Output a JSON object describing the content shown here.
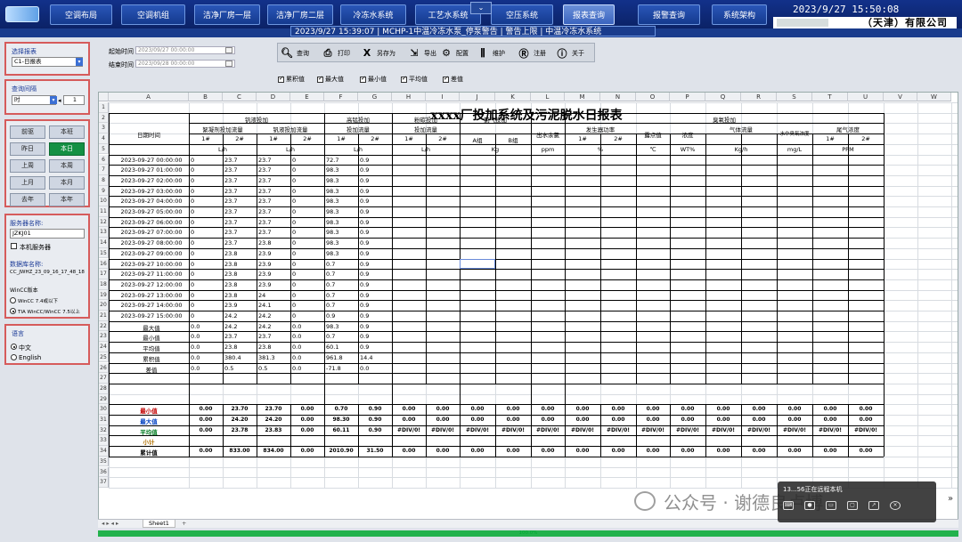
{
  "nav": {
    "items": [
      "空调布局",
      "空调机组",
      "洁净厂房一层",
      "洁净厂房二层",
      "冷冻水系统",
      "工艺水系统",
      "空压系统",
      "报表查询",
      "报警查询",
      "系统架构"
    ],
    "active": "报表查询",
    "datetime": "2023/9/27 15:50:08",
    "company": "（天津）有限公司",
    "ticker": "2023/9/27 15:39:07 | MCHP-1中温冷冻水泵_停泵警告 | 警告上限 | 中温冷冻水系统"
  },
  "sidebar": {
    "report_label": "选择报表",
    "report_value": "C1-日报表",
    "interval_label": "查询间隔",
    "interval_unit": "时",
    "interval_value": "1",
    "quick_buttons": [
      "前驱",
      "本班",
      "昨日",
      "本日",
      "上周",
      "本周",
      "上月",
      "本月",
      "去年",
      "本年"
    ],
    "quick_selected": "本日",
    "server_label": "服务器名称:",
    "server_value": "JZKJ01",
    "local_server": "本机服务器",
    "db_label": "数据库名称:",
    "db_value": "CC_JWHZ_23_09_16_17_48_18",
    "wincc_label": "WinCC版本",
    "wincc_options": [
      "WinCC 7.4或以下",
      "TIA WinCC/WinCC 7.5以上"
    ],
    "lang_label": "语言",
    "lang_options": [
      "中文",
      "English"
    ]
  },
  "timebar": {
    "start_label": "起始时间",
    "start_value": "2023/09/27 00:00:00",
    "end_label": "结束时间",
    "end_value": "2023/09/28 00:00:00"
  },
  "toolbar": {
    "buttons": [
      {
        "icon": "search-icon",
        "label": "查询"
      },
      {
        "icon": "printer-icon",
        "label": "打印"
      },
      {
        "icon": "excel-icon",
        "label": "另存为"
      },
      {
        "icon": "export-icon",
        "label": "导出"
      },
      {
        "icon": "gear-icon",
        "label": "配置"
      },
      {
        "icon": "maintenance-icon",
        "label": "维护"
      },
      {
        "icon": "register-icon",
        "label": "注册"
      },
      {
        "icon": "info-icon",
        "label": "关于"
      }
    ]
  },
  "options": [
    "累积值",
    "最大值",
    "最小值",
    "平均值",
    "差值"
  ],
  "sheet": {
    "columns": [
      "A",
      "B",
      "C",
      "D",
      "E",
      "F",
      "G",
      "H",
      "I",
      "J",
      "K",
      "L",
      "M",
      "N",
      "O",
      "P",
      "Q",
      "R",
      "S",
      "T",
      "U",
      "V",
      "W"
    ],
    "title": "xxxx厂投加系统及污泥脱水日报表",
    "tab_name": "Sheet1",
    "headers": {
      "time": "日期时间",
      "g1": "钒液投加",
      "g1a": "絮凝剂投加流量",
      "g1b": "钒液投加流量",
      "g2": "高锰投加",
      "g2a": "投加流量",
      "g3": "粉碳投加",
      "g3a": "投加流量",
      "g4": "氯气投加",
      "g4a": "A组",
      "g4b": "B组",
      "out": "出水余氯",
      "g5": "臭氧投加",
      "gen": "发生器功率",
      "dew": "露点值",
      "conc": "浓度",
      "gas": "气体流量",
      "water": "水中臭氧浓度",
      "tail": "尾气浓度",
      "n1": "1#",
      "n2": "2#",
      "u_lh": "L/h",
      "u_kg": "Kg",
      "u_ppm": "ppm",
      "u_pct": "%",
      "u_c": "℃",
      "u_wt": "WT%",
      "u_kgh": "Kg/h",
      "u_mgl": "mg/L",
      "u_PPM": "PPM"
    },
    "hourly": [
      [
        "2023-09-27 00:00:00",
        "0",
        "23.7",
        "23.7",
        "0",
        "72.7",
        "0.9"
      ],
      [
        "2023-09-27 01:00:00",
        "0",
        "23.7",
        "23.7",
        "0",
        "98.3",
        "0.9"
      ],
      [
        "2023-09-27 02:00:00",
        "0",
        "23.7",
        "23.7",
        "0",
        "98.3",
        "0.9"
      ],
      [
        "2023-09-27 03:00:00",
        "0",
        "23.7",
        "23.7",
        "0",
        "98.3",
        "0.9"
      ],
      [
        "2023-09-27 04:00:00",
        "0",
        "23.7",
        "23.7",
        "0",
        "98.3",
        "0.9"
      ],
      [
        "2023-09-27 05:00:00",
        "0",
        "23.7",
        "23.7",
        "0",
        "98.3",
        "0.9"
      ],
      [
        "2023-09-27 06:00:00",
        "0",
        "23.7",
        "23.7",
        "0",
        "98.3",
        "0.9"
      ],
      [
        "2023-09-27 07:00:00",
        "0",
        "23.7",
        "23.7",
        "0",
        "98.3",
        "0.9"
      ],
      [
        "2023-09-27 08:00:00",
        "0",
        "23.7",
        "23.8",
        "0",
        "98.3",
        "0.9"
      ],
      [
        "2023-09-27 09:00:00",
        "0",
        "23.8",
        "23.9",
        "0",
        "98.3",
        "0.9"
      ],
      [
        "2023-09-27 10:00:00",
        "0",
        "23.8",
        "23.9",
        "0",
        "0.7",
        "0.9"
      ],
      [
        "2023-09-27 11:00:00",
        "0",
        "23.8",
        "23.9",
        "0",
        "0.7",
        "0.9"
      ],
      [
        "2023-09-27 12:00:00",
        "0",
        "23.8",
        "23.9",
        "0",
        "0.7",
        "0.9"
      ],
      [
        "2023-09-27 13:00:00",
        "0",
        "23.8",
        "24",
        "0",
        "0.7",
        "0.9"
      ],
      [
        "2023-09-27 14:00:00",
        "0",
        "23.9",
        "24.1",
        "0",
        "0.7",
        "0.9"
      ],
      [
        "2023-09-27 15:00:00",
        "0",
        "24.2",
        "24.2",
        "0",
        "0.9",
        "0.9"
      ]
    ],
    "stats": [
      [
        "最大值",
        "0.0",
        "24.2",
        "24.2",
        "0.0",
        "98.3",
        "0.9"
      ],
      [
        "最小值",
        "0.0",
        "23.7",
        "23.7",
        "0.0",
        "0.7",
        "0.9"
      ],
      [
        "平均值",
        "0.0",
        "23.8",
        "23.8",
        "0.0",
        "60.1",
        "0.9"
      ],
      [
        "累积值",
        "0.0",
        "380.4",
        "381.3",
        "0.0",
        "961.8",
        "14.4"
      ],
      [
        "差值",
        "0.0",
        "0.5",
        "0.5",
        "0.0",
        "-71.8",
        "0.0"
      ]
    ],
    "summary": [
      {
        "label": "最小值",
        "color": "#c00000",
        "vals": [
          "0.00",
          "23.70",
          "23.70",
          "0.00",
          "0.70",
          "0.90",
          "0.00",
          "0.00",
          "0.00",
          "0.00",
          "0.00",
          "0.00",
          "0.00",
          "0.00",
          "0.00",
          "0.00",
          "0.00",
          "0.00",
          "0.00",
          "0.00"
        ]
      },
      {
        "label": "最大值",
        "color": "#0040c0",
        "vals": [
          "0.00",
          "24.20",
          "24.20",
          "0.00",
          "98.30",
          "0.90",
          "0.00",
          "0.00",
          "0.00",
          "0.00",
          "0.00",
          "0.00",
          "0.00",
          "0.00",
          "0.00",
          "0.00",
          "0.00",
          "0.00",
          "0.00",
          "0.00"
        ]
      },
      {
        "label": "平均值",
        "color": "#007a20",
        "vals": [
          "0.00",
          "23.78",
          "23.83",
          "0.00",
          "60.11",
          "0.90",
          "#DIV/0!",
          "#DIV/0!",
          "#DIV/0!",
          "#DIV/0!",
          "#DIV/0!",
          "#DIV/0!",
          "#DIV/0!",
          "#DIV/0!",
          "#DIV/0!",
          "#DIV/0!",
          "#DIV/0!",
          "#DIV/0!",
          "#DIV/0!",
          "#DIV/0!"
        ]
      },
      {
        "label": "小计",
        "color": "#b07000",
        "vals": []
      },
      {
        "label": "累计值",
        "color": "#000000",
        "vals": [
          "0.00",
          "833.00",
          "834.00",
          "0.00",
          "2010.90",
          "31.50",
          "0.00",
          "0.00",
          "0.00",
          "0.00",
          "0.00",
          "0.00",
          "0.00",
          "0.00",
          "0.00",
          "0.00",
          "0.00",
          "0.00",
          "0.00",
          "0.00"
        ]
      }
    ]
  },
  "status": {
    "progress_text": "100.0%",
    "progress": 1.0
  },
  "overlay": {
    "text": "13...56正在远程本机"
  },
  "watermark": "公众号 · 谢德良卢博"
}
